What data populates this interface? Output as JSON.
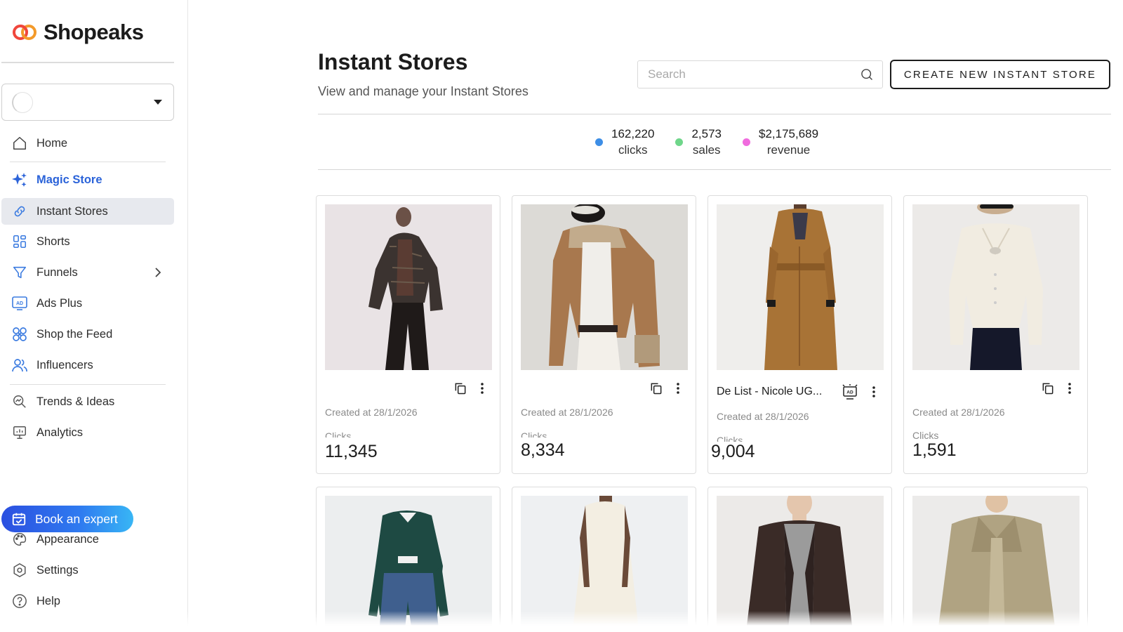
{
  "brand": {
    "name": "Shopeaks",
    "colors": {
      "logo_red": "#f0463c",
      "logo_orange": "#f39a2a"
    }
  },
  "sidebar": {
    "account_select": {
      "caret_icon": "caret-down-icon"
    },
    "items": [
      {
        "label": "Home",
        "icon": "home-icon"
      },
      {
        "label": "Magic Store",
        "icon": "sparkle-icon"
      },
      {
        "label": "Instant Stores",
        "icon": "link-icon"
      },
      {
        "label": "Shorts",
        "icon": "grid-icon"
      },
      {
        "label": "Funnels",
        "icon": "funnel-icon"
      },
      {
        "label": "Ads Plus",
        "icon": "ad-icon"
      },
      {
        "label": "Shop the Feed",
        "icon": "feed-icon"
      },
      {
        "label": "Influencers",
        "icon": "users-icon"
      },
      {
        "label": "Trends & Ideas",
        "icon": "trends-search-icon"
      },
      {
        "label": "Analytics",
        "icon": "analytics-monitor-icon"
      }
    ],
    "book_expert": {
      "label": "Book an expert",
      "icon": "calendar-check-icon"
    },
    "footer_items": [
      {
        "label": "Appearance",
        "icon": "palette-icon"
      },
      {
        "label": "Settings",
        "icon": "settings-icon"
      },
      {
        "label": "Help",
        "icon": "help-icon"
      }
    ]
  },
  "header": {
    "title": "Instant Stores",
    "subtitle": "View and manage your Instant Stores",
    "search_placeholder": "Search",
    "create_button": "CREATE NEW INSTANT STORE"
  },
  "stats": [
    {
      "value": "162,220",
      "label": "clicks",
      "color": "#3d8ee6"
    },
    {
      "value": "2,573",
      "label": "sales",
      "color": "#6fd68a"
    },
    {
      "value": "$2,175,689",
      "label": "revenue",
      "color": "#f06bde"
    }
  ],
  "cards": [
    {
      "name": "",
      "created": "Created at 28/1/2026",
      "clicks_label": "Clicks",
      "clicks": "11,345",
      "actions": [
        "copy-icon",
        "more-vertical-icon"
      ]
    },
    {
      "name": "",
      "created": "Created at 28/1/2026",
      "clicks_label": "Clicks",
      "clicks": "8,334",
      "actions": [
        "copy-icon",
        "more-vertical-icon"
      ]
    },
    {
      "name": "De List - Nicole UG...",
      "created": "Created at 28/1/2026",
      "clicks_label": "Clicks",
      "clicks": "9,004",
      "actions": [
        "ad-badge-icon",
        "more-vertical-icon"
      ]
    },
    {
      "name": "",
      "created": "Created at 28/1/2026",
      "clicks_label": "Clicks",
      "clicks": "1,591",
      "actions": [
        "copy-icon",
        "more-vertical-icon"
      ]
    },
    {
      "name": "",
      "created": "",
      "clicks_label": "",
      "clicks": "",
      "actions": []
    },
    {
      "name": "",
      "created": "",
      "clicks_label": "",
      "clicks": "",
      "actions": []
    },
    {
      "name": "",
      "created": "",
      "clicks_label": "",
      "clicks": "",
      "actions": []
    },
    {
      "name": "",
      "created": "",
      "clicks_label": "",
      "clicks": "",
      "actions": []
    }
  ]
}
